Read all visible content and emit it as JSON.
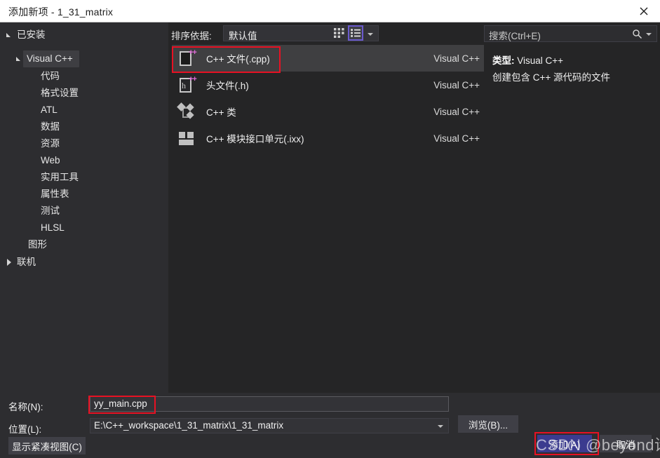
{
  "window": {
    "title": "添加新项 - 1_31_matrix",
    "close_icon": "close-icon"
  },
  "sidebar": {
    "root": {
      "label": "已安装",
      "state": "expanded"
    },
    "groups": [
      {
        "label": "Visual C++",
        "state": "expanded",
        "selected": true,
        "children": [
          "代码",
          "格式设置",
          "ATL",
          "数据",
          "资源",
          "Web",
          "实用工具",
          "属性表",
          "测试",
          "HLSL"
        ]
      },
      {
        "label": "图形",
        "state": "leaf",
        "children": []
      }
    ],
    "online": {
      "label": "联机",
      "state": "collapsed"
    }
  },
  "toolbar": {
    "sort_label": "排序依据:",
    "sort_value": "默认值",
    "grid_view_icon": "grid-view-icon",
    "list_view_icon": "list-view-icon",
    "active_view": "list"
  },
  "templates": {
    "rows": [
      {
        "name": "C++ 文件(.cpp)",
        "source": "Visual C++",
        "icon": "cpp-file-icon",
        "selected": true
      },
      {
        "name": "头文件(.h)",
        "source": "Visual C++",
        "icon": "header-file-icon",
        "selected": false
      },
      {
        "name": "C++ 类",
        "source": "Visual C++",
        "icon": "cpp-class-icon",
        "selected": false
      },
      {
        "name": "C++ 模块接口单元(.ixx)",
        "source": "Visual C++",
        "icon": "cpp-module-icon",
        "selected": false
      }
    ]
  },
  "search": {
    "placeholder": "搜索(Ctrl+E)",
    "icon": "search-icon"
  },
  "details": {
    "type_label": "类型:",
    "type_value": "Visual C++",
    "description": "创建包含 C++ 源代码的文件"
  },
  "form": {
    "name_label": "名称(N):",
    "name_value": "yy_main.cpp",
    "location_label": "位置(L):",
    "location_value": "E:\\C++_workspace\\1_31_matrix\\1_31_matrix",
    "browse_label": "浏览(B)...",
    "compact_label": "显示紧凑视图(C)",
    "add_label": "添加(A)",
    "cancel_label": "取消"
  },
  "watermark": {
    "text": "CSDN @beyond诗语"
  },
  "colors": {
    "dialog_bg": "#252526",
    "panel_bg": "#2d2d30",
    "titlebar_bg": "#ffffff",
    "selection_bg": "#3f3f41",
    "accent_button": "#3b3b8f",
    "annotation_red": "#e81123",
    "view_toggle_border": "#6a5acd"
  }
}
